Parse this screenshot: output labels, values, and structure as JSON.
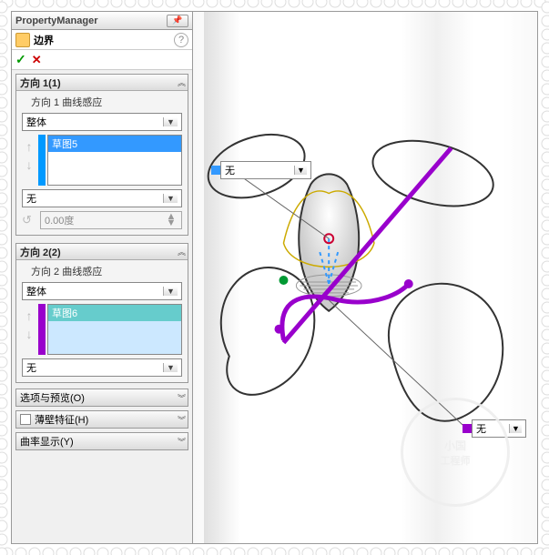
{
  "pm": {
    "title": "PropertyManager"
  },
  "feature": {
    "label": "边界"
  },
  "dir1": {
    "title": "方向 1(1)",
    "sublabel": "方向 1 曲线感应",
    "mode": "整体",
    "items": [
      "草图5"
    ],
    "end": "无",
    "angle": "0.00度"
  },
  "dir2": {
    "title": "方向 2(2)",
    "sublabel": "方向 2 曲线感应",
    "mode": "整体",
    "items": [
      "草图6"
    ],
    "end": "无"
  },
  "rows": {
    "options": "选项与预览(O)",
    "thin": "薄壁特征(H)",
    "curvature": "曲率显示(Y)"
  },
  "callouts": {
    "top": "无",
    "bottom": "无"
  },
  "watermark": {
    "line1": "小国",
    "line2": "工程师"
  },
  "ui": {
    "ok": "✓",
    "cancel": "✕",
    "help": "?",
    "pin": "📌"
  }
}
